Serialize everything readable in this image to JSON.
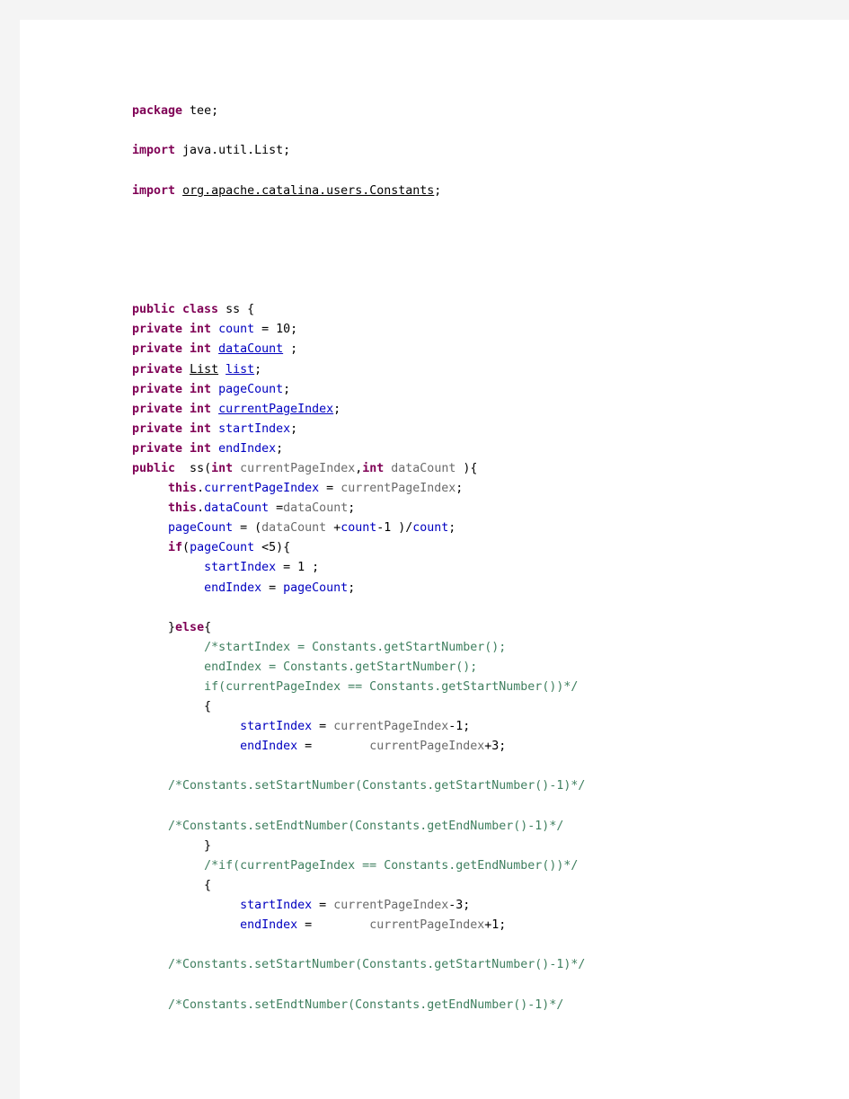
{
  "document": {
    "kind": "java-source-listing",
    "language": "Java",
    "page_background": "#f4f4f4",
    "sheet_background": "#ffffff"
  },
  "theme": {
    "keyword": "#7f0055",
    "field": "#0000c0",
    "local_variable": "#6a6a6a",
    "comment": "#3f7f5f",
    "plain": "#000000"
  },
  "code": {
    "lines": [
      {
        "tokens": [
          {
            "t": "package",
            "c": "keyword"
          },
          {
            "t": " tee;",
            "c": "plain"
          }
        ]
      },
      {
        "tokens": []
      },
      {
        "tokens": [
          {
            "t": "import",
            "c": "keyword"
          },
          {
            "t": " java.util.List;",
            "c": "plain"
          }
        ]
      },
      {
        "tokens": []
      },
      {
        "tokens": [
          {
            "t": "import",
            "c": "keyword"
          },
          {
            "t": " ",
            "c": "plain"
          },
          {
            "t": "org.apache.catalina.users.Constants",
            "c": "plain",
            "u": true
          },
          {
            "t": ";",
            "c": "plain"
          }
        ]
      },
      {
        "tokens": []
      },
      {
        "tokens": []
      },
      {
        "tokens": []
      },
      {
        "tokens": []
      },
      {
        "tokens": []
      },
      {
        "tokens": [
          {
            "t": "public class",
            "c": "keyword"
          },
          {
            "t": " ss {",
            "c": "plain"
          }
        ]
      },
      {
        "tokens": [
          {
            "t": "private int",
            "c": "keyword"
          },
          {
            "t": " ",
            "c": "plain"
          },
          {
            "t": "count",
            "c": "field"
          },
          {
            "t": " = 10;",
            "c": "plain"
          }
        ]
      },
      {
        "tokens": [
          {
            "t": "private int",
            "c": "keyword"
          },
          {
            "t": " ",
            "c": "plain"
          },
          {
            "t": "dataCount",
            "c": "field",
            "u": true
          },
          {
            "t": " ;",
            "c": "plain"
          }
        ]
      },
      {
        "tokens": [
          {
            "t": "private",
            "c": "keyword"
          },
          {
            "t": " ",
            "c": "plain"
          },
          {
            "t": "List",
            "c": "plain",
            "u": true
          },
          {
            "t": " ",
            "c": "plain"
          },
          {
            "t": "list",
            "c": "field",
            "u": true
          },
          {
            "t": ";",
            "c": "plain"
          }
        ]
      },
      {
        "tokens": [
          {
            "t": "private int",
            "c": "keyword"
          },
          {
            "t": " ",
            "c": "plain"
          },
          {
            "t": "pageCount",
            "c": "field"
          },
          {
            "t": ";",
            "c": "plain"
          }
        ]
      },
      {
        "tokens": [
          {
            "t": "private int",
            "c": "keyword"
          },
          {
            "t": " ",
            "c": "plain"
          },
          {
            "t": "currentPageIndex",
            "c": "field",
            "u": true
          },
          {
            "t": ";",
            "c": "plain"
          }
        ]
      },
      {
        "tokens": [
          {
            "t": "private int",
            "c": "keyword"
          },
          {
            "t": " ",
            "c": "plain"
          },
          {
            "t": "startIndex",
            "c": "field"
          },
          {
            "t": ";",
            "c": "plain"
          }
        ]
      },
      {
        "tokens": [
          {
            "t": "private int",
            "c": "keyword"
          },
          {
            "t": " ",
            "c": "plain"
          },
          {
            "t": "endIndex",
            "c": "field"
          },
          {
            "t": ";",
            "c": "plain"
          }
        ]
      },
      {
        "tokens": [
          {
            "t": "public",
            "c": "keyword"
          },
          {
            "t": "  ss(",
            "c": "plain"
          },
          {
            "t": "int",
            "c": "keyword"
          },
          {
            "t": " ",
            "c": "plain"
          },
          {
            "t": "currentPageIndex",
            "c": "local"
          },
          {
            "t": ",",
            "c": "plain"
          },
          {
            "t": "int",
            "c": "keyword"
          },
          {
            "t": " ",
            "c": "plain"
          },
          {
            "t": "dataCount",
            "c": "local"
          },
          {
            "t": " ){",
            "c": "plain"
          }
        ]
      },
      {
        "tokens": [
          {
            "t": "     ",
            "c": "plain"
          },
          {
            "t": "this",
            "c": "keyword"
          },
          {
            "t": ".",
            "c": "plain"
          },
          {
            "t": "currentPageIndex",
            "c": "field"
          },
          {
            "t": " = ",
            "c": "plain"
          },
          {
            "t": "currentPageIndex",
            "c": "local"
          },
          {
            "t": ";",
            "c": "plain"
          }
        ]
      },
      {
        "tokens": [
          {
            "t": "     ",
            "c": "plain"
          },
          {
            "t": "this",
            "c": "keyword"
          },
          {
            "t": ".",
            "c": "plain"
          },
          {
            "t": "dataCount",
            "c": "field"
          },
          {
            "t": " =",
            "c": "plain"
          },
          {
            "t": "dataCount",
            "c": "local"
          },
          {
            "t": ";",
            "c": "plain"
          }
        ]
      },
      {
        "tokens": [
          {
            "t": "     ",
            "c": "plain"
          },
          {
            "t": "pageCount",
            "c": "field"
          },
          {
            "t": " = (",
            "c": "plain"
          },
          {
            "t": "dataCount",
            "c": "local"
          },
          {
            "t": " +",
            "c": "plain"
          },
          {
            "t": "count",
            "c": "field"
          },
          {
            "t": "-1 )/",
            "c": "plain"
          },
          {
            "t": "count",
            "c": "field"
          },
          {
            "t": ";",
            "c": "plain"
          }
        ]
      },
      {
        "tokens": [
          {
            "t": "     ",
            "c": "plain"
          },
          {
            "t": "if",
            "c": "keyword"
          },
          {
            "t": "(",
            "c": "plain"
          },
          {
            "t": "pageCount",
            "c": "field"
          },
          {
            "t": " <5){",
            "c": "plain"
          }
        ]
      },
      {
        "tokens": [
          {
            "t": "          ",
            "c": "plain"
          },
          {
            "t": "startIndex",
            "c": "field"
          },
          {
            "t": " = 1 ;",
            "c": "plain"
          }
        ]
      },
      {
        "tokens": [
          {
            "t": "          ",
            "c": "plain"
          },
          {
            "t": "endIndex",
            "c": "field"
          },
          {
            "t": " = ",
            "c": "plain"
          },
          {
            "t": "pageCount",
            "c": "field"
          },
          {
            "t": ";",
            "c": "plain"
          }
        ]
      },
      {
        "tokens": []
      },
      {
        "tokens": [
          {
            "t": "     }",
            "c": "plain"
          },
          {
            "t": "else",
            "c": "keyword"
          },
          {
            "t": "{",
            "c": "plain"
          }
        ]
      },
      {
        "tokens": [
          {
            "t": "          ",
            "c": "plain"
          },
          {
            "t": "/*startIndex = Constants.getStartNumber();",
            "c": "comment"
          }
        ]
      },
      {
        "tokens": [
          {
            "t": "          ",
            "c": "plain"
          },
          {
            "t": "endIndex = Constants.getStartNumber();",
            "c": "comment"
          }
        ]
      },
      {
        "tokens": [
          {
            "t": "          ",
            "c": "plain"
          },
          {
            "t": "if(currentPageIndex == Constants.getStartNumber())*/",
            "c": "comment"
          }
        ]
      },
      {
        "tokens": [
          {
            "t": "          {",
            "c": "plain"
          }
        ]
      },
      {
        "tokens": [
          {
            "t": "               ",
            "c": "plain"
          },
          {
            "t": "startIndex",
            "c": "field"
          },
          {
            "t": " = ",
            "c": "plain"
          },
          {
            "t": "currentPageIndex",
            "c": "local"
          },
          {
            "t": "-1;",
            "c": "plain"
          }
        ]
      },
      {
        "tokens": [
          {
            "t": "               ",
            "c": "plain"
          },
          {
            "t": "endIndex",
            "c": "field"
          },
          {
            "t": " =        ",
            "c": "plain"
          },
          {
            "t": "currentPageIndex",
            "c": "local"
          },
          {
            "t": "+3;",
            "c": "plain"
          }
        ]
      },
      {
        "tokens": []
      },
      {
        "tokens": [
          {
            "t": "     ",
            "c": "plain"
          },
          {
            "t": "/*Constants.setStartNumber(Constants.getStartNumber()-1)*/",
            "c": "comment"
          }
        ]
      },
      {
        "tokens": []
      },
      {
        "tokens": [
          {
            "t": "     ",
            "c": "plain"
          },
          {
            "t": "/*Constants.setEndtNumber(Constants.getEndNumber()-1)*/",
            "c": "comment"
          }
        ]
      },
      {
        "tokens": [
          {
            "t": "          }",
            "c": "plain"
          }
        ]
      },
      {
        "tokens": [
          {
            "t": "          ",
            "c": "plain"
          },
          {
            "t": "/*if(currentPageIndex == Constants.getEndNumber())*/",
            "c": "comment"
          }
        ]
      },
      {
        "tokens": [
          {
            "t": "          {",
            "c": "plain"
          }
        ]
      },
      {
        "tokens": [
          {
            "t": "               ",
            "c": "plain"
          },
          {
            "t": "startIndex",
            "c": "field"
          },
          {
            "t": " = ",
            "c": "plain"
          },
          {
            "t": "currentPageIndex",
            "c": "local"
          },
          {
            "t": "-3;",
            "c": "plain"
          }
        ]
      },
      {
        "tokens": [
          {
            "t": "               ",
            "c": "plain"
          },
          {
            "t": "endIndex",
            "c": "field"
          },
          {
            "t": " =        ",
            "c": "plain"
          },
          {
            "t": "currentPageIndex",
            "c": "local"
          },
          {
            "t": "+1;",
            "c": "plain"
          }
        ]
      },
      {
        "tokens": []
      },
      {
        "tokens": [
          {
            "t": "     ",
            "c": "plain"
          },
          {
            "t": "/*Constants.setStartNumber(Constants.getStartNumber()-1)*/",
            "c": "comment"
          }
        ]
      },
      {
        "tokens": []
      },
      {
        "tokens": [
          {
            "t": "     ",
            "c": "plain"
          },
          {
            "t": "/*Constants.setEndtNumber(Constants.getEndNumber()-1)*/",
            "c": "comment"
          }
        ]
      }
    ]
  }
}
